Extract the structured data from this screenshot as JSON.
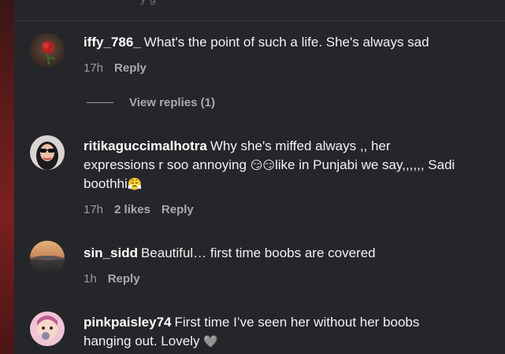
{
  "top_partial_text": "y   g",
  "comments": [
    {
      "username": "iffy_786_",
      "text": "What's the point of such a life. She's always sad",
      "time": "17h",
      "reply": "Reply",
      "view_replies": "View replies (1)"
    },
    {
      "username": "ritikaguccimalhotra",
      "text_before_emoji": "Why she's miffed always ,, her expressions r soo annoying ",
      "emoji1": "😏😏",
      "text_after_emoji": "like in Punjabi we say,,,,,, Sadi boothhi",
      "emoji2": "😤",
      "time": "17h",
      "likes": "2 likes",
      "reply": "Reply"
    },
    {
      "username": "sin_sidd",
      "text": "Beautiful… first time boobs are covered",
      "time": "1h",
      "reply": "Reply"
    },
    {
      "username": "pinkpaisley74",
      "text": "First time I’ve seen her without her boobs hanging out. Lovely ",
      "emoji": "🩶"
    }
  ]
}
